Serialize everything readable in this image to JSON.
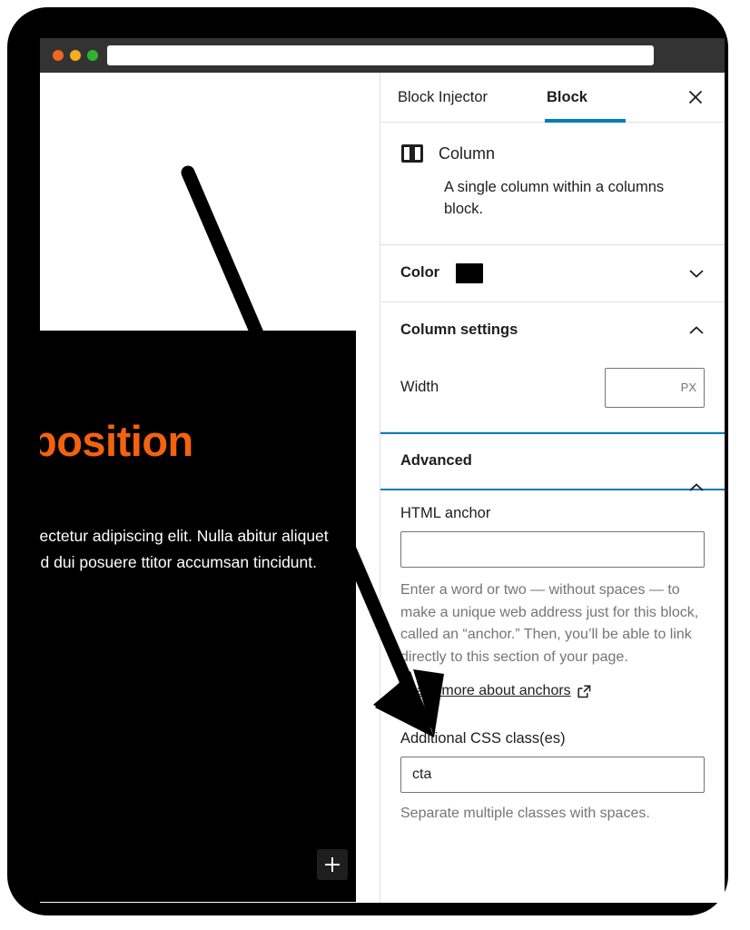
{
  "browser": {
    "url_value": "",
    "url_placeholder": "",
    "traffic_lights": [
      {
        "name": "close",
        "color": "#ef6722"
      },
      {
        "name": "minimize",
        "color": "#f5ad1d"
      },
      {
        "name": "maximize",
        "color": "#2cb52c"
      }
    ]
  },
  "editor": {
    "heading": "roposition",
    "paragraph": "t, consectetur adipiscing elit. Nulla abitur aliquet quam id dui posuere ttitor accumsan tincidunt. Donec",
    "heading_color": "#f4620f",
    "block_background": "#000000",
    "add_block_label": "+"
  },
  "sidebar": {
    "tabs": [
      {
        "label": "Block Injector",
        "active": false
      },
      {
        "label": "Block",
        "active": true
      }
    ],
    "close_label": "×",
    "accent_color": "#007cba",
    "block_card": {
      "icon": "column-icon",
      "title": "Column",
      "description": "A single column within a columns block."
    },
    "color_panel": {
      "title": "Color",
      "swatch_color": "#000000",
      "expanded": false
    },
    "column_settings_panel": {
      "title": "Column settings",
      "expanded": true,
      "width_label": "Width",
      "width_value": "",
      "width_unit": "PX"
    },
    "advanced_panel": {
      "title": "Advanced",
      "expanded": true,
      "focused": true,
      "html_anchor_label": "HTML anchor",
      "html_anchor_value": "",
      "html_anchor_help": "Enter a word or two — without spaces — to make a unique web address just for this block, called an “anchor.” Then, you’ll be able to link directly to this section of your page.",
      "anchors_link_text": "Learn more about anchors",
      "css_class_label": "Additional CSS class(es)",
      "css_class_value": "cta",
      "css_class_help": "Separate multiple classes with spaces."
    }
  }
}
